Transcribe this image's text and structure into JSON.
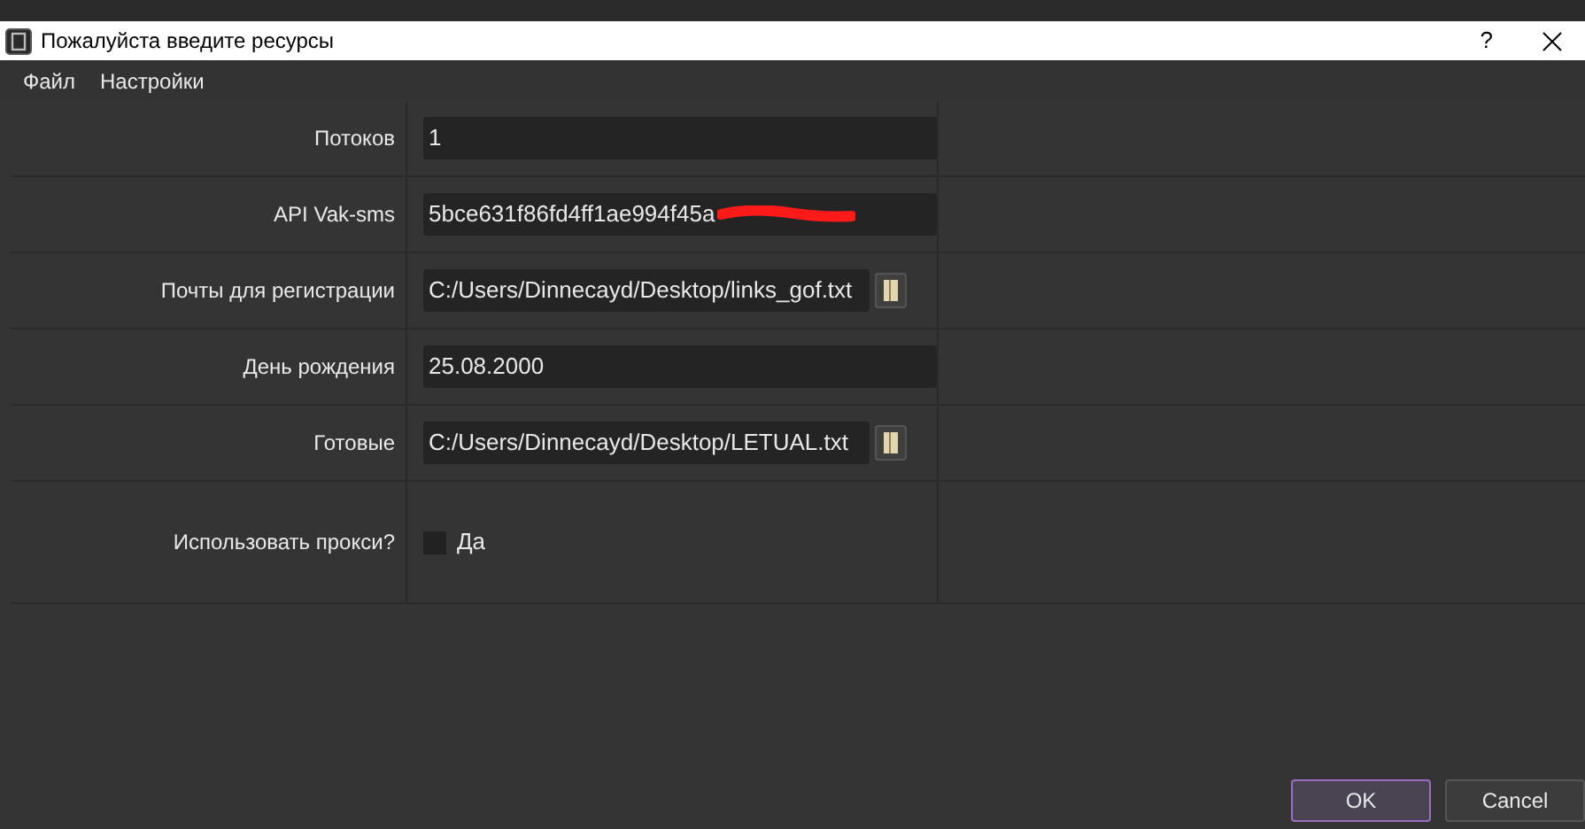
{
  "window": {
    "title": "Пожалуйста введите ресурсы",
    "help": "?"
  },
  "menu": [
    "Файл",
    "Настройки"
  ],
  "rows": [
    {
      "kind": "text",
      "label": "Потоков",
      "value": "1"
    },
    {
      "kind": "redacted",
      "label": "API Vak-sms",
      "value": "5bce631f86fd4ff1ae994f45a"
    },
    {
      "kind": "file",
      "label": "Почты для регистрации",
      "value": "C:/Users/Dinnecayd/Desktop/links_gof.txt"
    },
    {
      "kind": "text",
      "label": "День рождения",
      "value": "25.08.2000"
    },
    {
      "kind": "file",
      "label": "Готовые",
      "value": "C:/Users/Dinnecayd/Desktop/LETUAL.txt"
    },
    {
      "kind": "checkbox",
      "label": "Использовать прокси?",
      "option": "Да",
      "checked": false
    }
  ],
  "buttons": [
    {
      "label": "OK",
      "default": true
    },
    {
      "label": "Cancel",
      "default": false
    }
  ]
}
